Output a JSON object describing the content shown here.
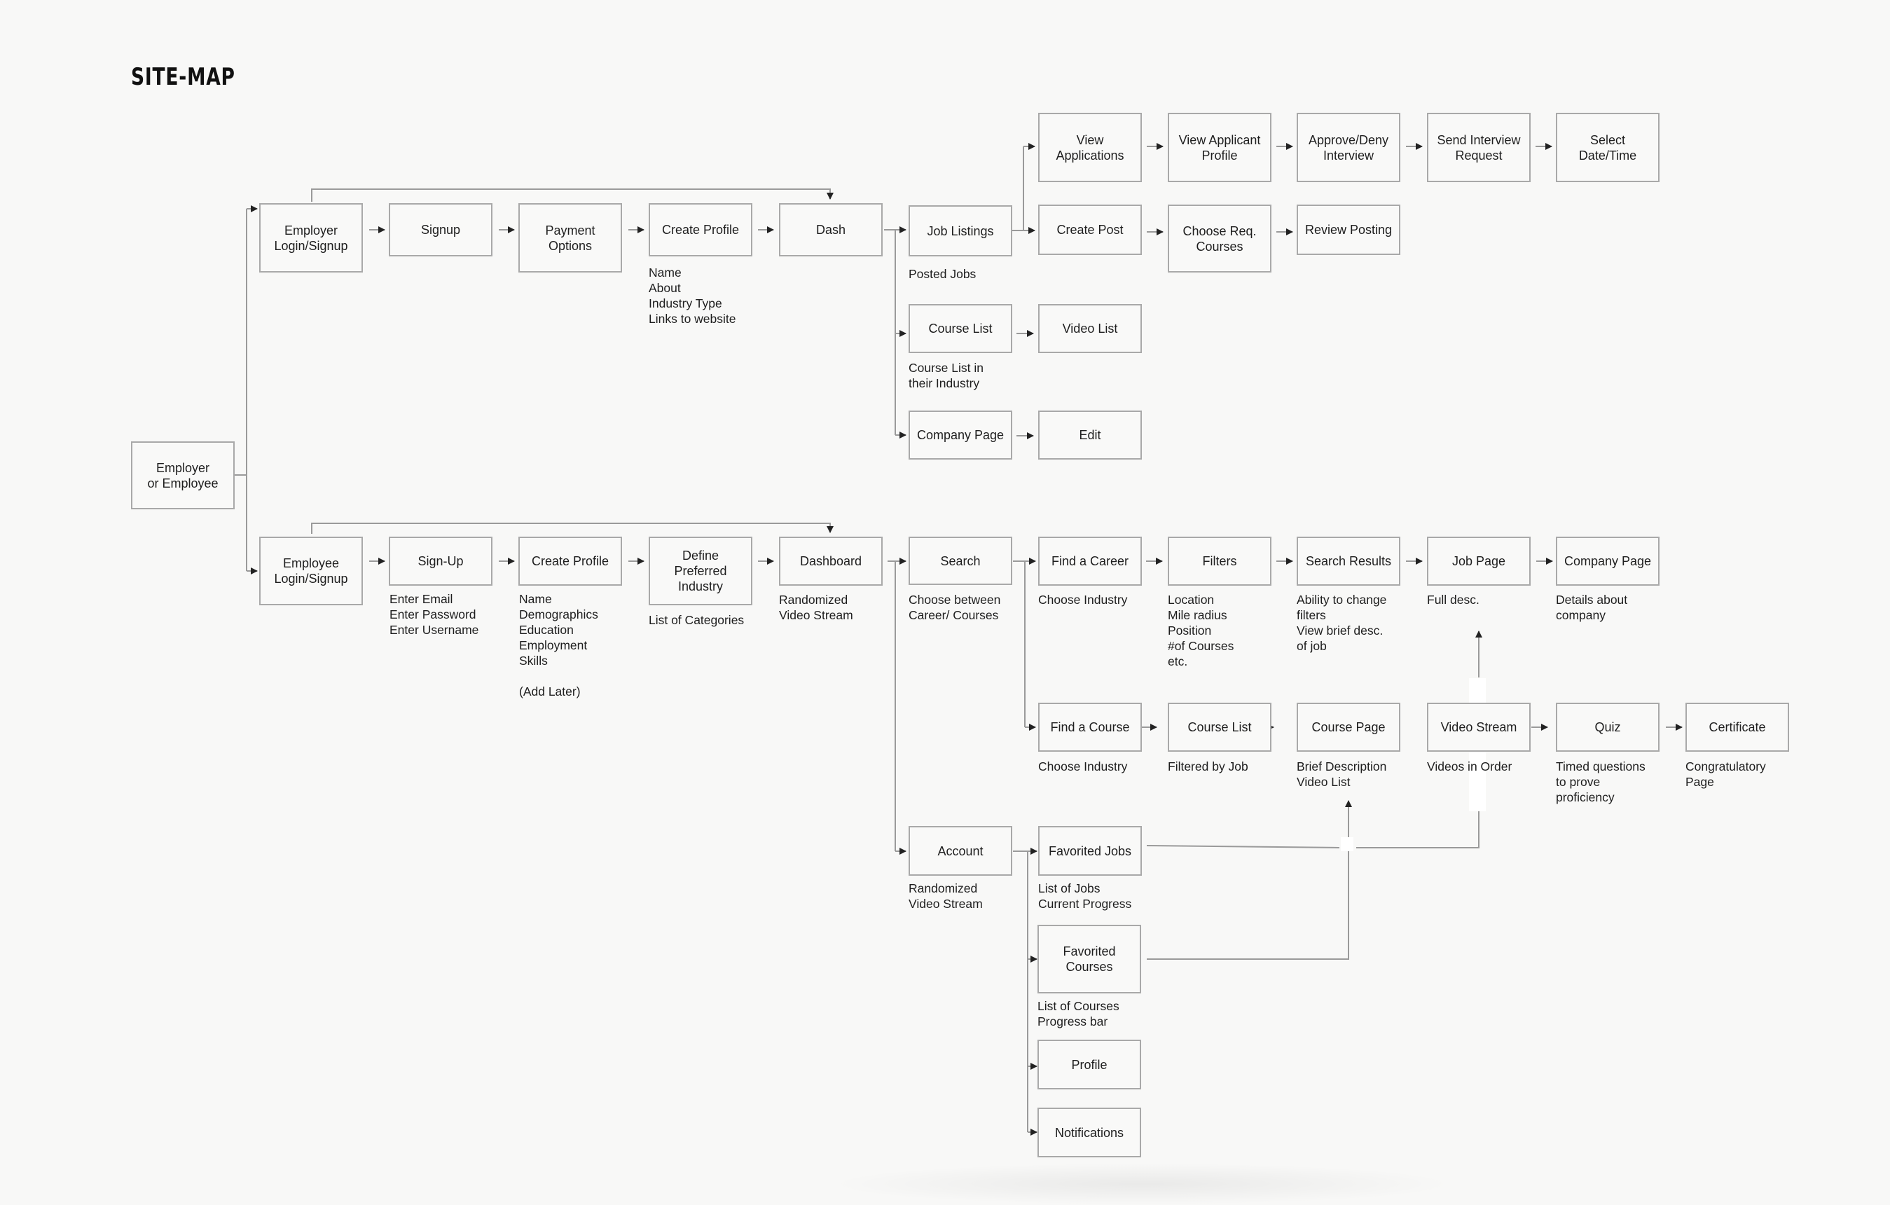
{
  "title": "SITE-MAP",
  "nodes": {
    "root": "Employer\nor Employee",
    "employer_login": "Employer\nLogin/Signup",
    "employer_signup": "Signup",
    "payment_options": "Payment\nOptions",
    "employer_create_profile": "Create Profile",
    "dash": "Dash",
    "job_listings": "Job Listings",
    "view_applications": "View\nApplications",
    "view_applicant_profile": "View Applicant\nProfile",
    "approve_deny_interview": "Approve/Deny\nInterview",
    "send_interview_request": "Send Interview\nRequest",
    "select_date_time": "Select\nDate/Time",
    "create_post": "Create Post",
    "choose_req_courses": "Choose Req.\nCourses",
    "review_posting": "Review Posting",
    "employer_course_list": "Course List",
    "video_list": "Video List",
    "employer_company_page": "Company Page",
    "edit": "Edit",
    "employee_login": "Employee\nLogin/Signup",
    "employee_signup": "Sign-Up",
    "employee_create_profile": "Create Profile",
    "define_industry": "Define\nPreferred\nIndustry",
    "dashboard": "Dashboard",
    "search": "Search",
    "find_career": "Find a Career",
    "filters": "Filters",
    "search_results": "Search Results",
    "job_page": "Job Page",
    "employee_company_page": "Company Page",
    "find_course": "Find a Course",
    "employee_course_list": "Course List",
    "course_page": "Course Page",
    "video_stream": "Video Stream",
    "quiz": "Quiz",
    "certificate": "Certificate",
    "account": "Account",
    "favorited_jobs": "Favorited Jobs",
    "favorited_courses": "Favorited\nCourses",
    "profile": "Profile",
    "notifications": "Notifications"
  },
  "notes": {
    "employer_create_profile": "Name\nAbout\nIndustry Type\nLinks to website",
    "job_listings": "Posted Jobs",
    "employer_course_list": "Course List in\ntheir Industry",
    "employee_signup": "Enter Email\nEnter Password\nEnter Username",
    "employee_create_profile": "Name\nDemographics\nEducation\nEmployment\nSkills\n\n(Add Later)",
    "define_industry": "List of Categories",
    "dashboard": "Randomized\nVideo Stream",
    "search": "Choose between\nCareer/ Courses",
    "find_career": "Choose Industry",
    "filters": "Location\nMile radius\nPosition\n#of Courses\netc.",
    "search_results": "Ability to change\nfilters\nView brief desc.\nof job",
    "job_page": "Full desc.",
    "employee_company_page": "Details about\ncompany",
    "find_course": "Choose Industry",
    "employee_course_list": "Filtered by Job",
    "course_page": "Brief Description\nVideo List",
    "video_stream": "Videos in Order",
    "quiz": "Timed questions\nto prove\nproficiency",
    "certificate": "Congratulatory\nPage",
    "account": "Randomized\nVideo Stream",
    "favorited_jobs": "List of Jobs\nCurrent Progress",
    "favorited_courses": "List of Courses\nProgress bar"
  },
  "colors": {
    "background": "#f8f8f7",
    "box_border": "#a9a9a9",
    "connector": "#9a9a9a",
    "arrowhead": "#222222",
    "text": "#1e1e1e"
  }
}
